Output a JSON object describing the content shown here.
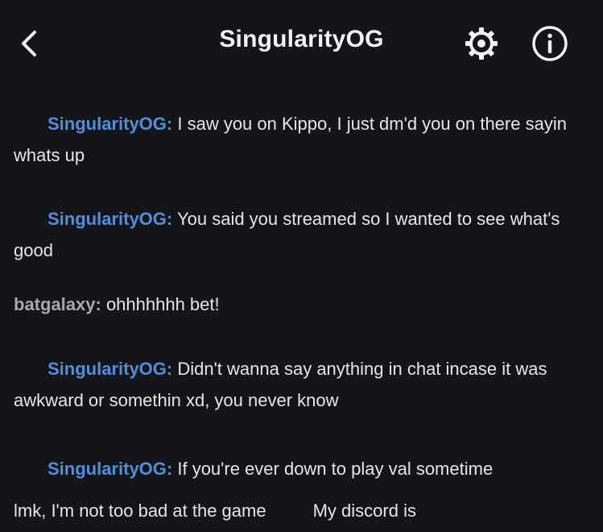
{
  "header": {
    "title": "SingularityOG",
    "back_icon": "chevron-left-icon",
    "settings_icon": "gear-icon",
    "info_icon": "info-icon"
  },
  "colors": {
    "background": "#141518",
    "other_user_name": "#4f8fdc",
    "self_user_name": "#a9a9ad",
    "text": "#e6e6e8"
  },
  "messages": [
    {
      "author": "SingularityOG:",
      "text": " I saw you on Kippo, I just dm'd you on there sayin whats up",
      "indented": true
    },
    {
      "author": "SingularityOG:",
      "text": " You said you streamed so I wanted to see what's good",
      "indented": true
    },
    {
      "author": "batgalaxy:",
      "text": " ohhhhhhh bet!",
      "indented": false
    },
    {
      "author": "SingularityOG:",
      "text": " Didn't wanna say anything in chat incase it was awkward or somethin xd, you never know",
      "indented": true
    },
    {
      "author": "SingularityOG:",
      "text_line1": " If you're ever down to play val sometime",
      "text_line2a": "lmk, I'm not too bad at the game",
      "text_line2b": "My discord is",
      "indented": true
    }
  ]
}
